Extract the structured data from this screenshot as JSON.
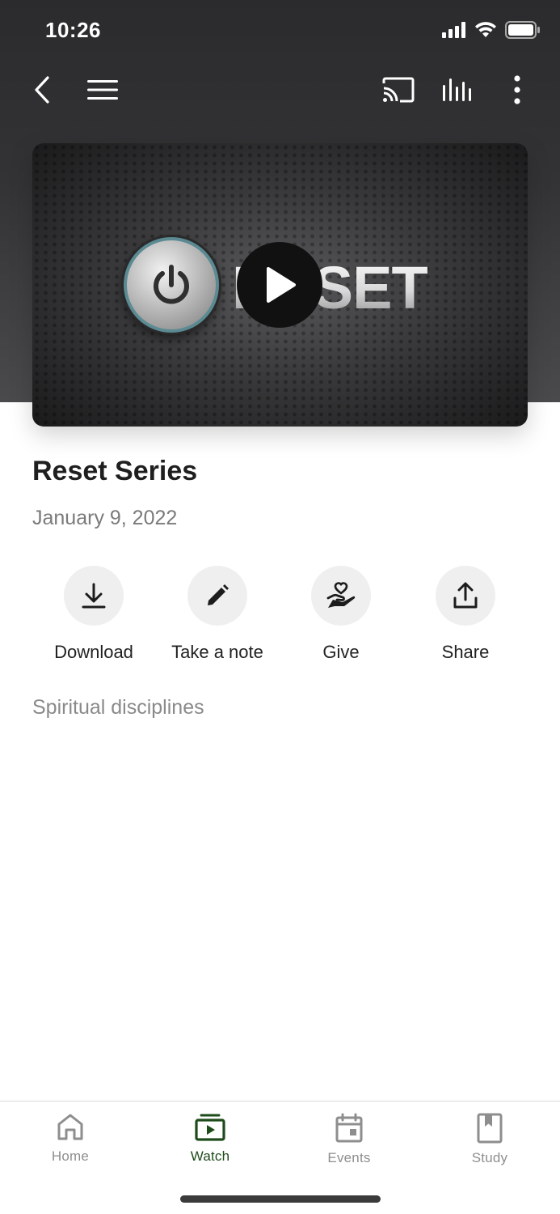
{
  "status_bar": {
    "time": "10:26"
  },
  "top_bar": {
    "icons": [
      "back-icon",
      "menu-icon",
      "cast-icon",
      "equalizer-icon",
      "more-vertical-icon"
    ]
  },
  "video": {
    "thumbnail_text": "RESET",
    "play_icon": "play-icon"
  },
  "content": {
    "title": "Reset Series",
    "date": "January 9, 2022",
    "tag": "Spiritual disciplines"
  },
  "actions": [
    {
      "label": "Download",
      "icon": "download-icon"
    },
    {
      "label": "Take a note",
      "icon": "pencil-icon"
    },
    {
      "label": "Give",
      "icon": "hand-heart-icon"
    },
    {
      "label": "Share",
      "icon": "share-icon"
    }
  ],
  "tab_bar": {
    "active": "Watch",
    "accent_color": "#1e4b1a",
    "items": [
      {
        "label": "Home",
        "icon": "home-icon"
      },
      {
        "label": "Watch",
        "icon": "watch-icon"
      },
      {
        "label": "Events",
        "icon": "calendar-icon"
      },
      {
        "label": "Study",
        "icon": "bookmark-icon"
      }
    ]
  }
}
